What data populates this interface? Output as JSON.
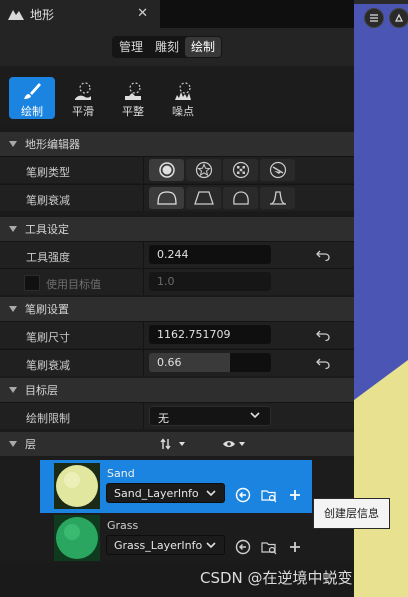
{
  "window": {
    "tab_title": "地形",
    "close_glyph": "✕"
  },
  "modes": [
    "管理",
    "雕刻",
    "绘制"
  ],
  "active_mode": "绘制",
  "tools": [
    {
      "label": "绘制",
      "icon": "paint-brush-icon",
      "active": true
    },
    {
      "label": "平滑",
      "icon": "smooth-icon",
      "active": false
    },
    {
      "label": "平整",
      "icon": "flatten-icon",
      "active": false
    },
    {
      "label": "噪点",
      "icon": "noise-icon",
      "active": false
    }
  ],
  "sections": {
    "editor": "地形编辑器",
    "tool_settings": "工具设定",
    "brush_settings": "笔刷设置",
    "target_layer": "目标层",
    "layers": "层"
  },
  "editor": {
    "brush_type_label": "笔刷类型",
    "brush_falloff_label": "笔刷衰减"
  },
  "tool_settings": {
    "strength_label": "工具强度",
    "strength_value": "0.244",
    "use_target_label": "使用目标值",
    "use_target_value": "1.0"
  },
  "brush_settings": {
    "size_label": "笔刷尺寸",
    "size_value": "1162.751709",
    "falloff_label": "笔刷衰减",
    "falloff_value": "0.66",
    "falloff_fraction": 0.66
  },
  "target_layer": {
    "paint_limit_label": "绘制限制",
    "paint_limit_value": "无"
  },
  "layers": [
    {
      "name": "Sand",
      "layer_info": "Sand_LayerInfo",
      "selected": true,
      "color": "#e6e9a8"
    },
    {
      "name": "Grass",
      "layer_info": "Grass_LayerInfo",
      "selected": false,
      "color": "#2fb36a"
    }
  ],
  "tooltip": "创建层信息",
  "watermark": "CSDN @在逆境中蜕变",
  "colors": {
    "accent": "#1a84e0",
    "viewport_blue": "#4b56b4",
    "viewport_sand": "#e8e290"
  }
}
